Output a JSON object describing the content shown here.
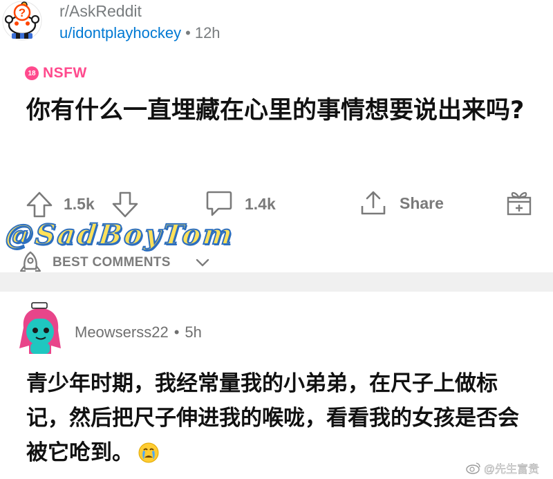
{
  "post": {
    "subreddit": "r/AskReddit",
    "author": "u/idontplayhockey",
    "separator": "•",
    "time_ago": "12h",
    "nsfw_badge": "18",
    "nsfw_label": "NSFW",
    "title": "你有什么一直埋藏在心里的事情想要说出来吗?"
  },
  "actions": {
    "upvotes": "1.5k",
    "comments": "1.4k",
    "share_label": "Share"
  },
  "watermark": "@SadBoyTom",
  "comments_section": {
    "sort_label": "BEST COMMENTS"
  },
  "comment": {
    "author": "Meowserss22",
    "separator": "•",
    "time_ago": "5h",
    "body": "青少年时期，我经常量我的小弟弟，在尺子上做标记，然后把尺子伸进我的喉咙，看看我的女孩是否会被它呛到。",
    "emoji": "crying-face-emoji"
  },
  "source_watermark": "@先生富贵",
  "colors": {
    "accent_blue": "#0079d3",
    "nsfw_pink": "#ff4a8d",
    "muted_gray": "#787c7e"
  }
}
